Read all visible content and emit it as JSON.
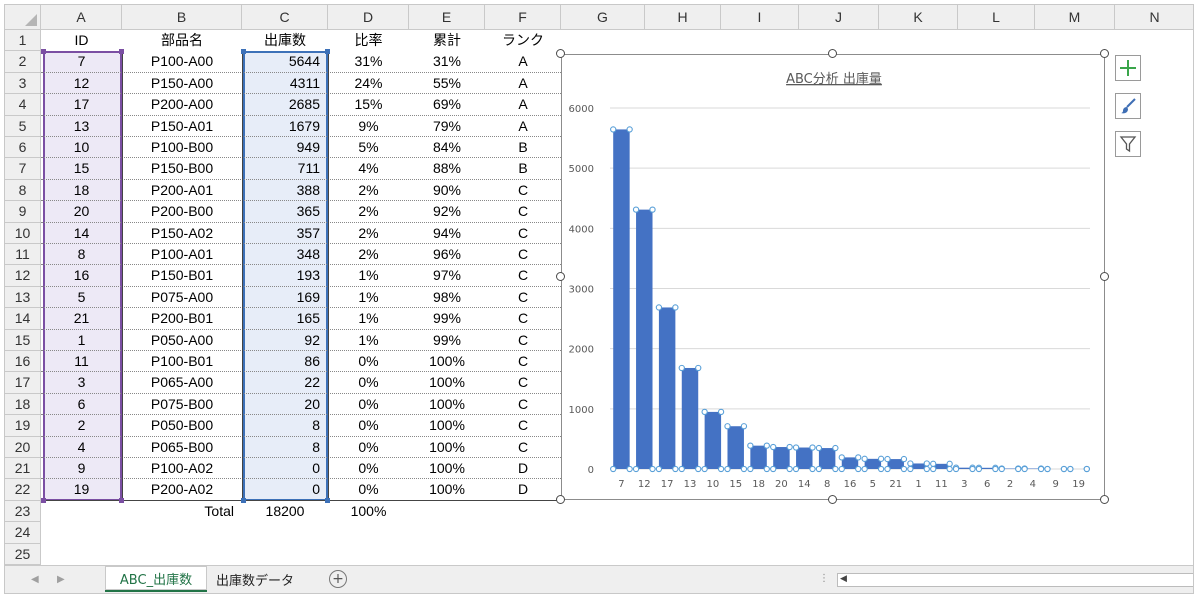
{
  "columns": [
    "A",
    "B",
    "C",
    "D",
    "E",
    "F",
    "G",
    "H",
    "I",
    "J",
    "K",
    "L",
    "M",
    "N"
  ],
  "rows": [
    "1",
    "2",
    "3",
    "4",
    "5",
    "6",
    "7",
    "8",
    "9",
    "10",
    "11",
    "12",
    "13",
    "14",
    "15",
    "16",
    "17",
    "18",
    "19",
    "20",
    "21",
    "22",
    "23",
    "24",
    "25"
  ],
  "table": {
    "headers": [
      "ID",
      "部品名",
      "出庫数",
      "比率",
      "累計",
      "ランク"
    ],
    "data": [
      [
        "7",
        "P100-A00",
        "5644",
        "31%",
        "31%",
        "A"
      ],
      [
        "12",
        "P150-A00",
        "4311",
        "24%",
        "55%",
        "A"
      ],
      [
        "17",
        "P200-A00",
        "2685",
        "15%",
        "69%",
        "A"
      ],
      [
        "13",
        "P150-A01",
        "1679",
        "9%",
        "79%",
        "A"
      ],
      [
        "10",
        "P100-B00",
        "949",
        "5%",
        "84%",
        "B"
      ],
      [
        "15",
        "P150-B00",
        "711",
        "4%",
        "88%",
        "B"
      ],
      [
        "18",
        "P200-A01",
        "388",
        "2%",
        "90%",
        "C"
      ],
      [
        "20",
        "P200-B00",
        "365",
        "2%",
        "92%",
        "C"
      ],
      [
        "14",
        "P150-A02",
        "357",
        "2%",
        "94%",
        "C"
      ],
      [
        "8",
        "P100-A01",
        "348",
        "2%",
        "96%",
        "C"
      ],
      [
        "16",
        "P150-B01",
        "193",
        "1%",
        "97%",
        "C"
      ],
      [
        "5",
        "P075-A00",
        "169",
        "1%",
        "98%",
        "C"
      ],
      [
        "21",
        "P200-B01",
        "165",
        "1%",
        "99%",
        "C"
      ],
      [
        "1",
        "P050-A00",
        "92",
        "1%",
        "99%",
        "C"
      ],
      [
        "11",
        "P100-B01",
        "86",
        "0%",
        "100%",
        "C"
      ],
      [
        "3",
        "P065-A00",
        "22",
        "0%",
        "100%",
        "C"
      ],
      [
        "6",
        "P075-B00",
        "20",
        "0%",
        "100%",
        "C"
      ],
      [
        "2",
        "P050-B00",
        "8",
        "0%",
        "100%",
        "C"
      ],
      [
        "4",
        "P065-B00",
        "8",
        "0%",
        "100%",
        "C"
      ],
      [
        "9",
        "P100-A02",
        "0",
        "0%",
        "100%",
        "D"
      ],
      [
        "19",
        "P200-A02",
        "0",
        "0%",
        "100%",
        "D"
      ]
    ],
    "total": {
      "label": "Total",
      "quantity": "18200",
      "ratio": "100%"
    }
  },
  "chart_data": {
    "type": "bar",
    "title": "ABC分析 出庫量",
    "categories": [
      "7",
      "12",
      "17",
      "13",
      "10",
      "15",
      "18",
      "20",
      "14",
      "8",
      "16",
      "5",
      "21",
      "1",
      "11",
      "3",
      "6",
      "2",
      "4",
      "9",
      "19"
    ],
    "values": [
      5644,
      4311,
      2685,
      1679,
      949,
      711,
      388,
      365,
      357,
      348,
      193,
      169,
      165,
      92,
      86,
      22,
      20,
      8,
      8,
      0,
      0
    ],
    "yticks": [
      "0",
      "1000",
      "2000",
      "3000",
      "4000",
      "5000",
      "6000"
    ],
    "ylim": [
      0,
      6000
    ],
    "grid": true,
    "color": "#4472c4"
  },
  "chart_buttons": {
    "elements": "chart-elements-plus-icon",
    "styles": "chart-styles-brush-icon",
    "filters": "chart-filters-funnel-icon"
  },
  "sheet_tabs": [
    {
      "label": "ABC_出庫数",
      "active": true
    },
    {
      "label": "出庫数データ",
      "active": false
    }
  ],
  "colors": {
    "accent_green": "#217346",
    "bar": "#4472c4",
    "sel_purple": "#7b4fa3",
    "sel_blue": "#3d71b8"
  }
}
